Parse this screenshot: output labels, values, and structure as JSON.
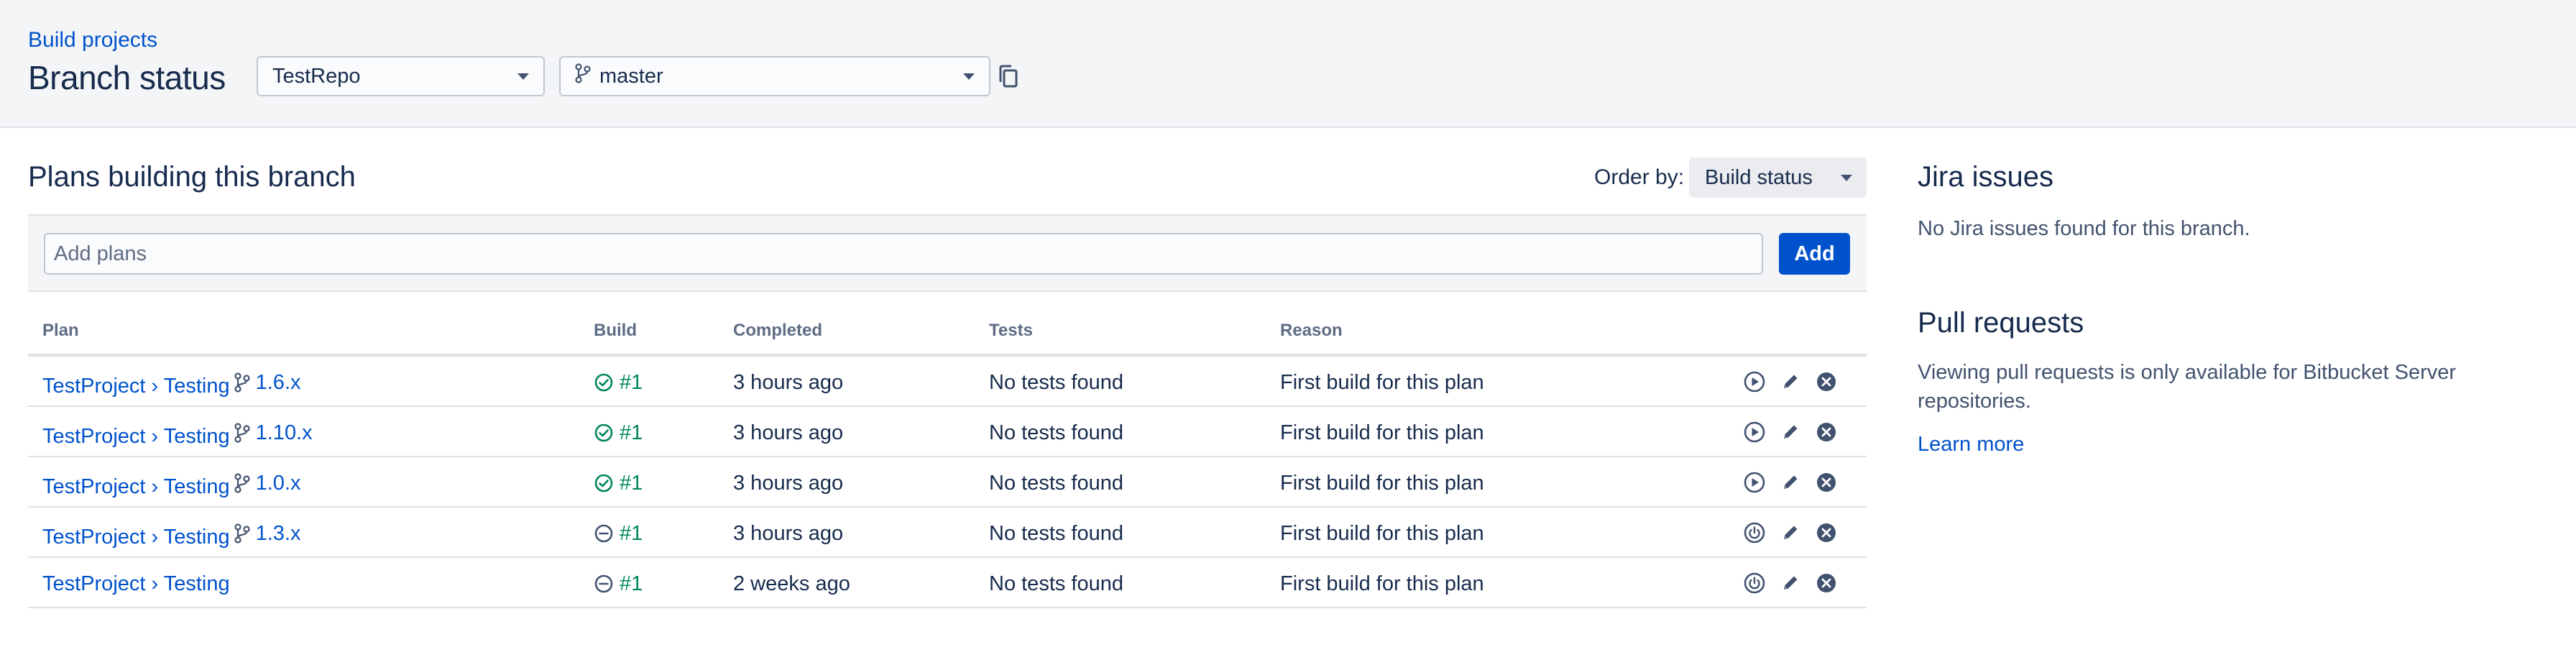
{
  "header": {
    "breadcrumb": "Build projects",
    "title": "Branch status",
    "repo_select": "TestRepo",
    "branch_select": "master"
  },
  "plans": {
    "title": "Plans building this branch",
    "order_label": "Order by:",
    "order_value": "Build status",
    "add_placeholder": "Add plans",
    "add_button": "Add",
    "columns": [
      "Plan",
      "Build",
      "Completed",
      "Tests",
      "Reason"
    ],
    "rows": [
      {
        "plan": "TestProject",
        "sep": "›",
        "job": "Testing",
        "branch": "1.6.x",
        "status": "success",
        "build": "#1",
        "completed": "3 hours ago",
        "tests": "No tests found",
        "reason": "First build for this plan",
        "action": "run"
      },
      {
        "plan": "TestProject",
        "sep": "›",
        "job": "Testing",
        "branch": "1.10.x",
        "status": "success",
        "build": "#1",
        "completed": "3 hours ago",
        "tests": "No tests found",
        "reason": "First build for this plan",
        "action": "run"
      },
      {
        "plan": "TestProject",
        "sep": "›",
        "job": "Testing",
        "branch": "1.0.x",
        "status": "success",
        "build": "#1",
        "completed": "3 hours ago",
        "tests": "No tests found",
        "reason": "First build for this plan",
        "action": "run"
      },
      {
        "plan": "TestProject",
        "sep": "›",
        "job": "Testing",
        "branch": "1.3.x",
        "status": "disabled",
        "build": "#1",
        "completed": "3 hours ago",
        "tests": "No tests found",
        "reason": "First build for this plan",
        "action": "enable"
      },
      {
        "plan": "TestProject",
        "sep": "›",
        "job": "Testing",
        "branch": "",
        "status": "disabled",
        "build": "#1",
        "completed": "2 weeks ago",
        "tests": "No tests found",
        "reason": "First build for this plan",
        "action": "enable"
      }
    ]
  },
  "jira": {
    "title": "Jira issues",
    "text": "No Jira issues found for this branch."
  },
  "pull_requests": {
    "title": "Pull requests",
    "text": "Viewing pull requests is only available for Bitbucket Server repositories.",
    "link": "Learn more"
  },
  "colors": {
    "link": "#0052cc",
    "success": "#00875a",
    "primary_button": "#0052cc",
    "header_bg": "#f4f5f7",
    "icon_gray": "#42526e"
  },
  "icons": {
    "branch": "branch-icon",
    "copy": "copy-icon",
    "success": "check-circle-icon",
    "disabled": "minus-circle-icon",
    "run": "play-circle-icon",
    "enable": "power-icon",
    "edit": "pencil-icon",
    "delete": "close-circle-icon"
  }
}
